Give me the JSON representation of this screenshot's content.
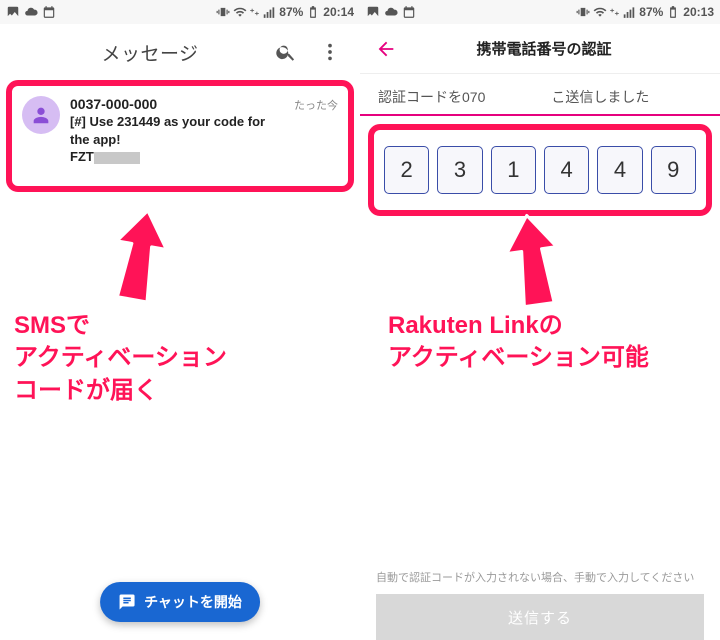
{
  "left": {
    "status": {
      "battery_pct": "87%",
      "time": "20:14"
    },
    "appbar": {
      "title": "メッセージ"
    },
    "sms": {
      "sender": "0037-000-000",
      "ts": "たった今",
      "line1": "[#] Use 231449 as your code for",
      "line2": "the app!",
      "line3_prefix": "FZT"
    },
    "fab_label": "チャットを開始",
    "annot": {
      "l1": "SMSで",
      "l2": "アクティベーション",
      "l3": "コードが届く"
    }
  },
  "right": {
    "status": {
      "battery_pct": "87%",
      "time": "20:13"
    },
    "header": {
      "title": "携帯電話番号の認証"
    },
    "sub": {
      "prefix": "認証コードを070",
      "suffix": "こ送信しました"
    },
    "code": [
      "2",
      "3",
      "1",
      "4",
      "4",
      "9"
    ],
    "note": "自動で認証コードが入力されない場合、手動で入力してください",
    "submit": "送信する",
    "annot": {
      "l1": "Rakuten Linkの",
      "l2": "アクティベーション可能"
    }
  }
}
